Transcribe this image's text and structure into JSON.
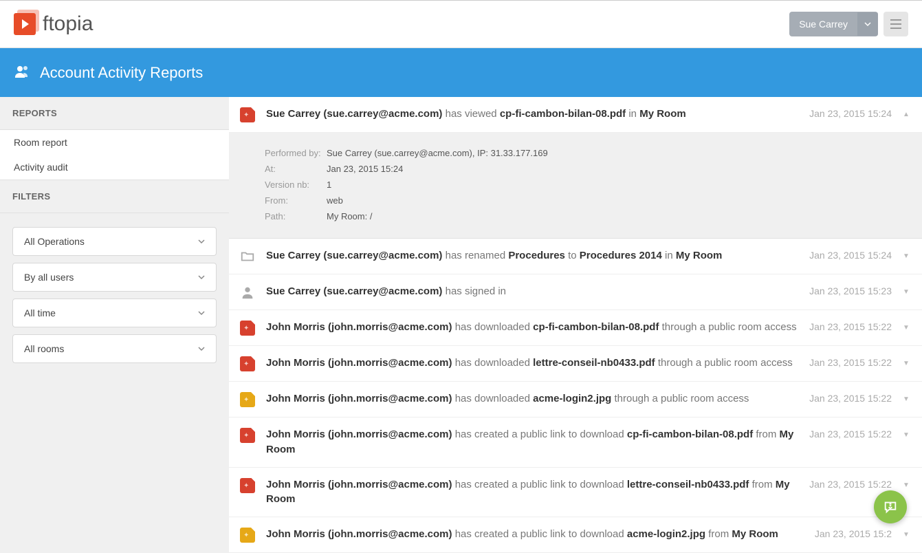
{
  "header": {
    "brand": "ftopia",
    "user_name": "Sue Carrey"
  },
  "banner": {
    "title": "Account Activity Reports"
  },
  "sidebar": {
    "reports_heading": "REPORTS",
    "links": [
      {
        "label": "Room report"
      },
      {
        "label": "Activity audit"
      }
    ],
    "filters_heading": "FILTERS",
    "filters": [
      {
        "label": "All Operations"
      },
      {
        "label": "By all users"
      },
      {
        "label": "All time"
      },
      {
        "label": "All rooms"
      }
    ]
  },
  "details_labels": {
    "performed_by": "Performed by:",
    "at": "At:",
    "version_nb": "Version nb:",
    "from": "From:",
    "path": "Path:"
  },
  "activities": [
    {
      "icon": "pdf",
      "actor_name": "Sue Carrey",
      "actor_email": "sue.carrey@acme.com",
      "action_pre": "has viewed",
      "object": "cp-fi-cambon-bilan-08.pdf",
      "action_mid": "in",
      "location": "My Room",
      "action_post": "",
      "timestamp": "Jan 23, 2015 15:24",
      "expanded": true,
      "details": {
        "performed_by": "Sue Carrey (sue.carrey@acme.com), IP: 31.33.177.169",
        "at": "Jan 23, 2015 15:24",
        "version_nb": "1",
        "from": "web",
        "path": "My Room: /"
      }
    },
    {
      "icon": "folder",
      "actor_name": "Sue Carrey",
      "actor_email": "sue.carrey@acme.com",
      "action_pre": "has renamed",
      "object": "Procedures",
      "action_mid": "to",
      "object2": "Procedures 2014",
      "action_mid2": "in",
      "location": "My Room",
      "timestamp": "Jan 23, 2015 15:24"
    },
    {
      "icon": "user",
      "actor_name": "Sue Carrey",
      "actor_email": "sue.carrey@acme.com",
      "action_pre": "has signed in",
      "timestamp": "Jan 23, 2015 15:23"
    },
    {
      "icon": "pdf",
      "actor_name": "John Morris",
      "actor_email": "john.morris@acme.com",
      "action_pre": "has downloaded",
      "object": "cp-fi-cambon-bilan-08.pdf",
      "action_post": "through a public room access",
      "timestamp": "Jan 23, 2015 15:22"
    },
    {
      "icon": "pdf",
      "actor_name": "John Morris",
      "actor_email": "john.morris@acme.com",
      "action_pre": "has downloaded",
      "object": "lettre-conseil-nb0433.pdf",
      "action_post": "through a public room access",
      "timestamp": "Jan 23, 2015 15:22"
    },
    {
      "icon": "jpg",
      "actor_name": "John Morris",
      "actor_email": "john.morris@acme.com",
      "action_pre": "has downloaded",
      "object": "acme-login2.jpg",
      "action_post": "through a public room access",
      "timestamp": "Jan 23, 2015 15:22"
    },
    {
      "icon": "pdf",
      "actor_name": "John Morris",
      "actor_email": "john.morris@acme.com",
      "action_pre": "has created a public link to download",
      "object": "cp-fi-cambon-bilan-08.pdf",
      "action_mid": "from",
      "location": "My Room",
      "timestamp": "Jan 23, 2015 15:22"
    },
    {
      "icon": "pdf",
      "actor_name": "John Morris",
      "actor_email": "john.morris@acme.com",
      "action_pre": "has created a public link to download",
      "object": "lettre-conseil-nb0433.pdf",
      "action_mid": "from",
      "location": "My Room",
      "timestamp": "Jan 23, 2015 15:22"
    },
    {
      "icon": "jpg",
      "actor_name": "John Morris",
      "actor_email": "john.morris@acme.com",
      "action_pre": "has created a public link to download",
      "object": "acme-login2.jpg",
      "action_mid": "from",
      "location": "My Room",
      "timestamp": "Jan 23, 2015 15:2"
    }
  ]
}
